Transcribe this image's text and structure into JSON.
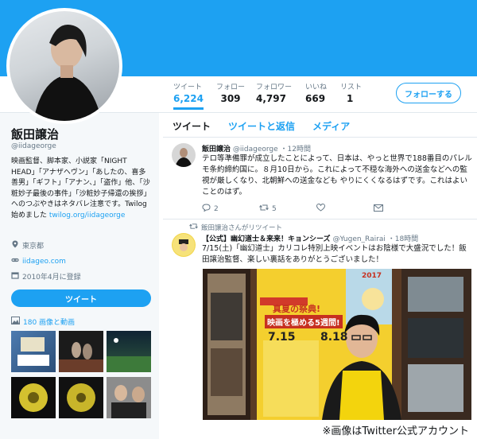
{
  "header": {
    "banner_color": "#1da1f2"
  },
  "stats": [
    {
      "label": "ツイート",
      "value": "6,224"
    },
    {
      "label": "フォロー",
      "value": "309"
    },
    {
      "label": "フォロワー",
      "value": "4,797"
    },
    {
      "label": "いいね",
      "value": "669"
    },
    {
      "label": "リスト",
      "value": "1"
    }
  ],
  "follow_button": "フォローする",
  "profile": {
    "name": "飯田譲治",
    "handle": "@iidageorge",
    "bio": "映画監督、脚本家、小説家「NIGHT HEAD」「アナザヘヴン」「あしたの、喜多善男」「ギフト」「アナン、」「盗作」他、「沙粧妙子最後の事件」「沙粧妙子帰還の挨拶」へのつぶやきはネタバレ注意です。Twilog始めました ",
    "bio_link": "twilog.org/iidageorge",
    "location": "東京都",
    "website": "iidageo.com",
    "joined": "2010年4月に登録",
    "tweet_button": "ツイート",
    "media_link": "180 画像と動画"
  },
  "tabs": [
    "ツイート",
    "ツイートと返信",
    "メディア"
  ],
  "tweet1": {
    "name": "飯田譲治",
    "handle": "@iidageorge",
    "time": "・12時間",
    "text": "テロ等準備罪が成立したことによって、日本は、やっと世界で188番目のパレルモ条約締約国に。８月10日から。これによって不穏な海外への送金などへの監視が厳しくなり、北朝鮮への送金なども やりにくくなるはずです。これはよいことのはず。",
    "replies": "2",
    "retweets": "5",
    "likes": ""
  },
  "retweet_note": "飯田譲治さんがリツイート",
  "tweet2": {
    "name": "【公式】幽幻道士＆来来！キョンシーズ",
    "handle": "@Yugen_Rairai",
    "time": "・18時間",
    "text": "7/15(土)「幽幻道士」カリコレ特別上映イベントはお陰様で大盛況でした！飯田譲治監督、楽しい裏話をありがとうございました！"
  },
  "poster": {
    "tagline": "真夏の祭典!",
    "subtitle": "映画を極める5週間!",
    "dates": "7.15",
    "dates2": "8.18",
    "year": "2017"
  },
  "caption": "※画像はTwitter公式アカウント"
}
